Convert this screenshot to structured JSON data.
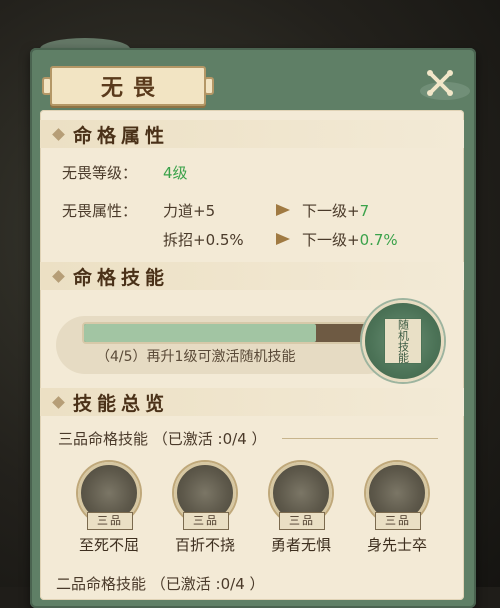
{
  "title": "无畏",
  "close_icon": "close-icon",
  "attributes": {
    "section_title": "命格属性",
    "level_label": "无畏等级：",
    "level_value": "4级",
    "attr_label": "无畏属性：",
    "row1_attr": "力道+5",
    "row1_next": "下一级+",
    "row1_next_value": "7",
    "row2_attr": "拆招+0.5%",
    "row2_next": "下一级+",
    "row2_next_value": "0.7%"
  },
  "skill": {
    "section_title": "命格技能",
    "progress_current": 4,
    "progress_total": 5,
    "progress_text": "（4/5）再升1级可激活随机技能",
    "random_skill_label": "随机技能"
  },
  "overview": {
    "section_title": "技能总览",
    "group1_label": "三品命格技能 （已激活 :0/4 ）",
    "skills": [
      {
        "grade": "三品",
        "name": "至死不屈",
        "icon": "skill-zhisibuqu-icon"
      },
      {
        "grade": "三品",
        "name": "百折不挠",
        "icon": "skill-baizhebunao-icon"
      },
      {
        "grade": "三品",
        "name": "勇者无惧",
        "icon": "skill-yongzhewuju-icon"
      },
      {
        "grade": "三品",
        "name": "身先士卒",
        "icon": "skill-shenxianshizu-icon"
      }
    ],
    "group2_label": "二品命格技能 （已激活 :0/4 ）"
  },
  "colors": {
    "accent_green": "#3aa24a",
    "frame": "#5f7f66",
    "panel": "#f3ead6"
  }
}
